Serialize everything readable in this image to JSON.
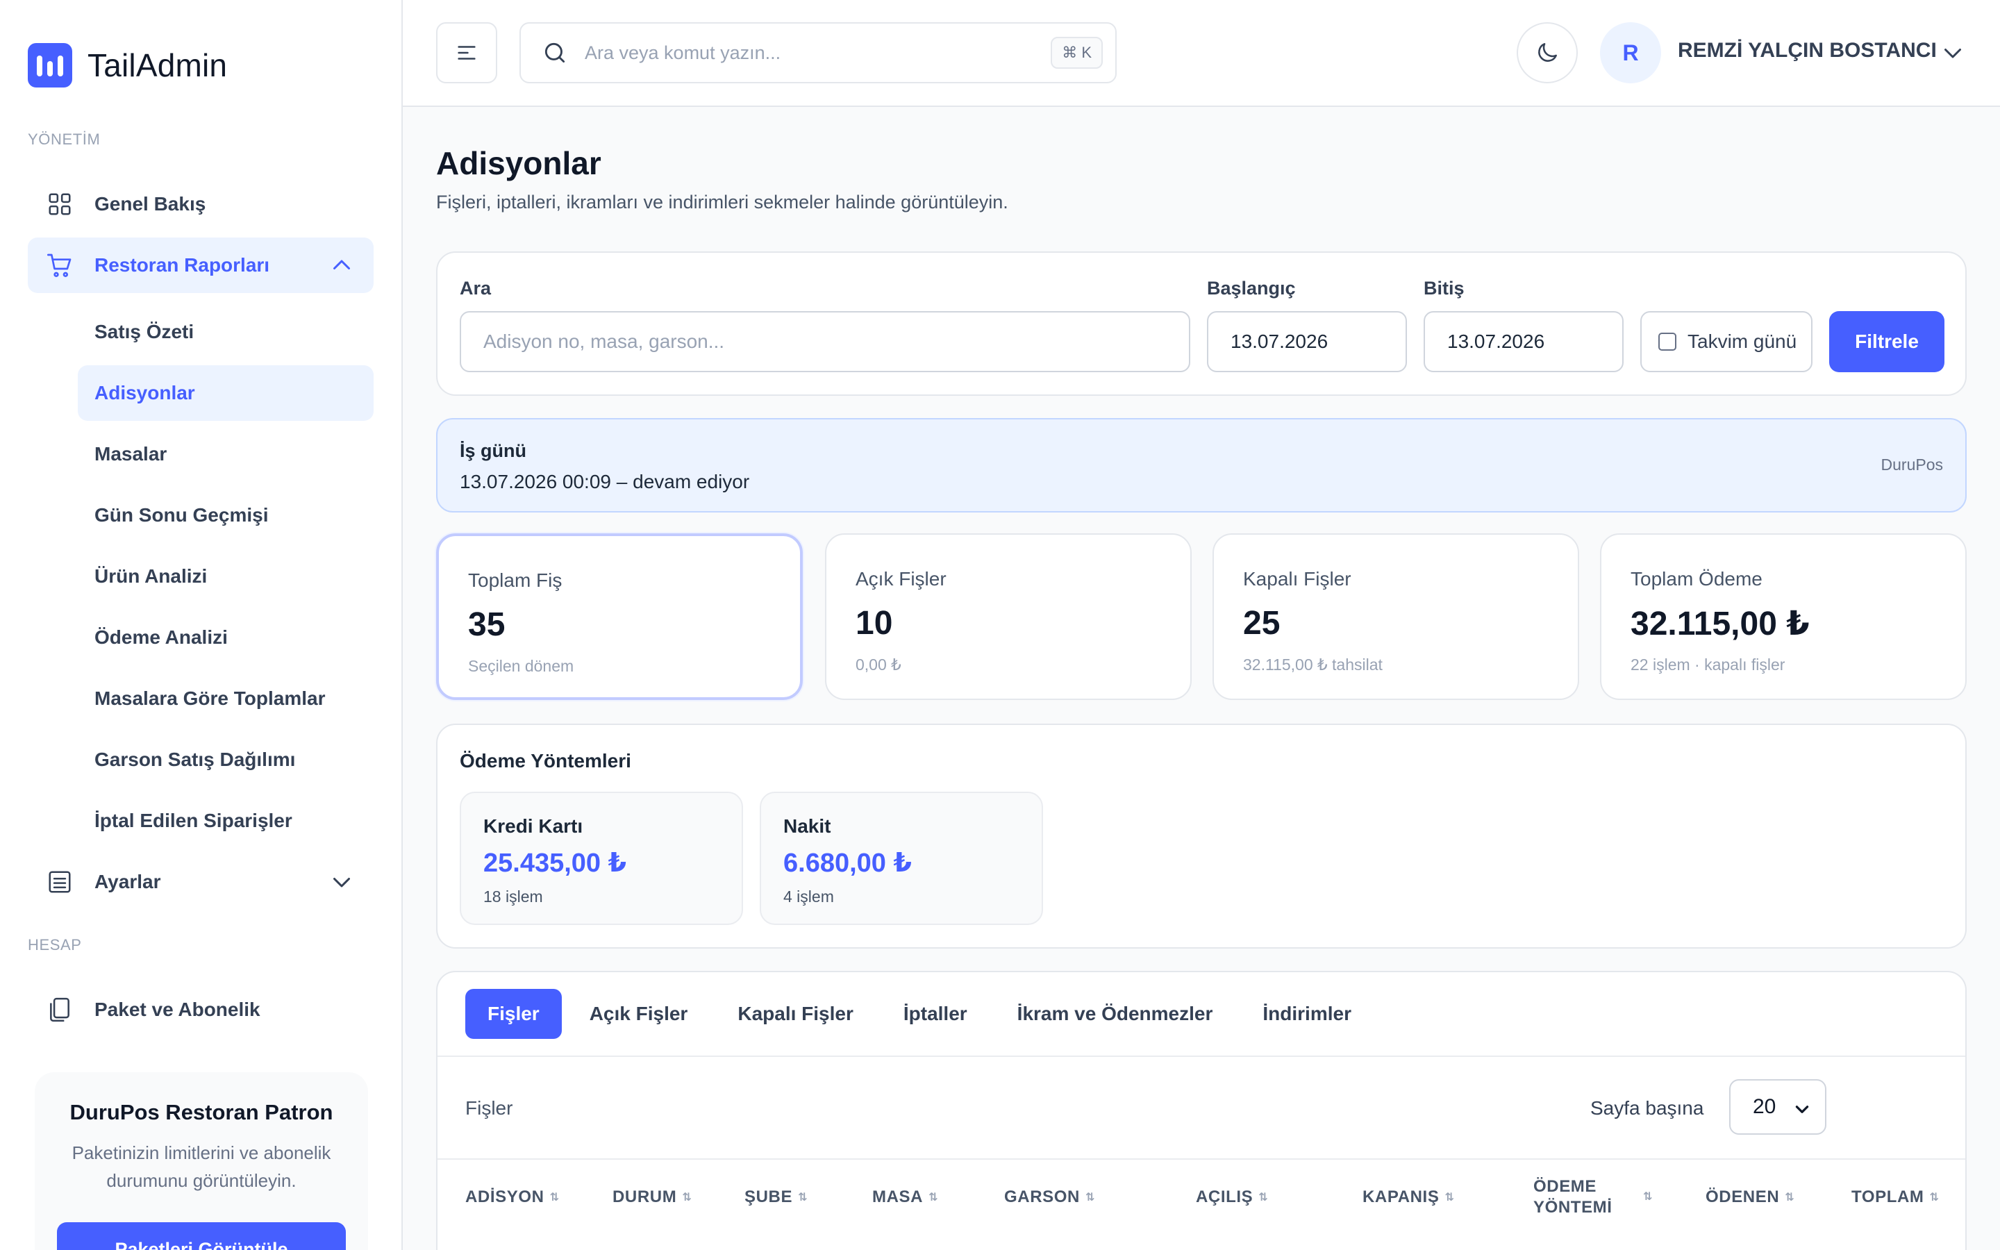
{
  "brand": {
    "name": "TailAdmin"
  },
  "sidebar": {
    "section_management": "YÖNETİM",
    "section_account": "HESAP",
    "items": [
      {
        "label": "Genel Bakış"
      },
      {
        "label": "Restoran Raporları"
      },
      {
        "label": "Ayarlar"
      },
      {
        "label": "Paket ve Abonelik"
      }
    ],
    "sub_items": [
      {
        "label": "Satış Özeti"
      },
      {
        "label": "Adisyonlar"
      },
      {
        "label": "Masalar"
      },
      {
        "label": "Gün Sonu Geçmişi"
      },
      {
        "label": "Ürün Analizi"
      },
      {
        "label": "Ödeme Analizi"
      },
      {
        "label": "Masalara Göre Toplamlar"
      },
      {
        "label": "Garson Satış Dağılımı"
      },
      {
        "label": "İptal Edilen Siparişler"
      }
    ],
    "promo": {
      "title": "DuruPos Restoran Patron",
      "text": "Paketinizin limitlerini ve abonelik durumunu görüntüleyin.",
      "button": "Paketleri Görüntüle"
    }
  },
  "header": {
    "search_placeholder": "Ara veya komut yazın...",
    "shortcut": "⌘ K",
    "avatar_initial": "R",
    "user_name": "REMZİ YALÇIN BOSTANCI"
  },
  "page": {
    "title": "Adisyonlar",
    "subtitle": "Fişleri, iptalleri, ikramları ve indirimleri sekmeler halinde görüntüleyin."
  },
  "filters": {
    "search_label": "Ara",
    "search_placeholder": "Adisyon no, masa, garson...",
    "start_label": "Başlangıç",
    "start_value": "13.07.2026",
    "end_label": "Bitiş",
    "end_value": "13.07.2026",
    "calendar_day_label": "Takvim günü",
    "filter_button": "Filtrele"
  },
  "business_day": {
    "title": "İş günü",
    "value": "13.07.2026 00:09 – devam ediyor",
    "source": "DuruPos"
  },
  "stats": [
    {
      "label": "Toplam Fiş",
      "value": "35",
      "sub": "Seçilen dönem"
    },
    {
      "label": "Açık Fişler",
      "value": "10",
      "sub": "0,00 ₺"
    },
    {
      "label": "Kapalı Fişler",
      "value": "25",
      "sub": "32.115,00 ₺ tahsilat"
    },
    {
      "label": "Toplam Ödeme",
      "value": "32.115,00 ₺",
      "sub": "22 işlem · kapalı fişler"
    }
  ],
  "payment_methods": {
    "title": "Ödeme Yöntemleri",
    "items": [
      {
        "name": "Kredi Kartı",
        "amount": "25.435,00 ₺",
        "count": "18 işlem"
      },
      {
        "name": "Nakit",
        "amount": "6.680,00 ₺",
        "count": "4 işlem"
      }
    ]
  },
  "tabs": [
    {
      "label": "Fişler"
    },
    {
      "label": "Açık Fişler"
    },
    {
      "label": "Kapalı Fişler"
    },
    {
      "label": "İptaller"
    },
    {
      "label": "İkram ve Ödenmezler"
    },
    {
      "label": "İndirimler"
    }
  ],
  "list": {
    "title": "Fişler",
    "per_page_label": "Sayfa başına",
    "per_page_value": "20"
  },
  "table": {
    "columns": [
      "ADİSYON",
      "DURUM",
      "ŞUBE",
      "MASA",
      "GARSON",
      "AÇILIŞ",
      "KAPANIŞ",
      "ÖDEME YÖNTEMİ",
      "ÖDENEN",
      "TOPLAM"
    ]
  },
  "colors": {
    "accent": "#465fff",
    "accent_soft": "#ecf3ff",
    "text": "#1d2939",
    "border": "#e4e7ec"
  },
  "icons": {
    "logo": "bar-chart-icon",
    "menu": "menu-lines-icon",
    "search": "search-icon",
    "theme": "moon-icon",
    "overview": "grid-icon",
    "reports": "cart-icon",
    "settings": "list-box-icon",
    "subscription": "copy-icon"
  }
}
